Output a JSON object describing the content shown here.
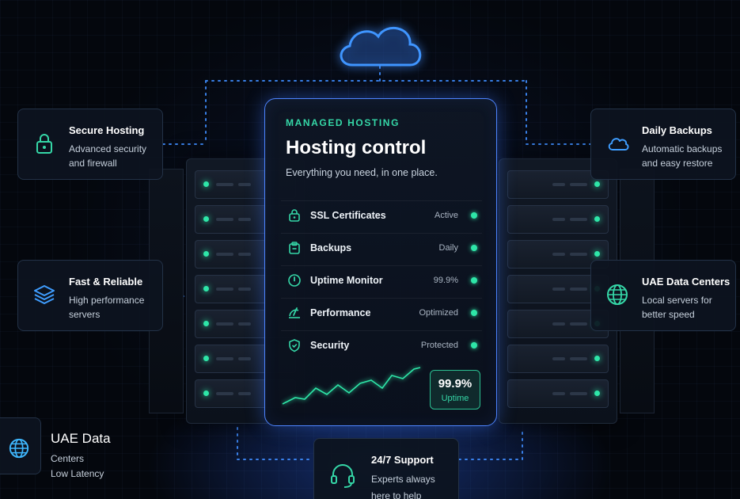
{
  "panel": {
    "eyebrow": "MANAGED HOSTING",
    "title": "Hosting control",
    "subtitle": "Everything you need, in one place.",
    "rows": [
      {
        "label": "SSL Certificates",
        "status": "Active",
        "icon": "lock-badge-icon"
      },
      {
        "label": "Backups",
        "status": "Daily",
        "icon": "clipboard-icon"
      },
      {
        "label": "Uptime Monitor",
        "status": "99.9%",
        "icon": "clock-icon"
      },
      {
        "label": "Performance",
        "status": "Optimized",
        "icon": "gauge-icon"
      },
      {
        "label": "Security",
        "status": "Protected",
        "icon": "shield-icon"
      }
    ],
    "uptime": {
      "value": "99.9%",
      "label": "Uptime"
    }
  },
  "cards": {
    "secure": {
      "title": "Secure Hosting",
      "desc": "Advanced security and firewall",
      "icon": "padlock-icon"
    },
    "fast": {
      "title": "Fast & Reliable",
      "desc": "High performance servers",
      "icon": "layers-icon"
    },
    "backups": {
      "title": "Daily Backups",
      "desc": "Automatic backups and easy restore",
      "icon": "cloud-icon"
    },
    "uae": {
      "title": "UAE Data Centers",
      "desc": "Local servers for better speed",
      "icon": "globe-icon"
    },
    "support": {
      "title": "24/7 Support",
      "desc": "Experts always here to help",
      "icon": "headset-icon"
    }
  },
  "bottom_left": {
    "title": "UAE Data",
    "line1": "Centers",
    "line2": "Low Latency",
    "icon": "globe-icon"
  },
  "colors": {
    "accent_green": "#2ee6a8",
    "accent_blue": "#4d84ff",
    "background": "#04070d"
  }
}
